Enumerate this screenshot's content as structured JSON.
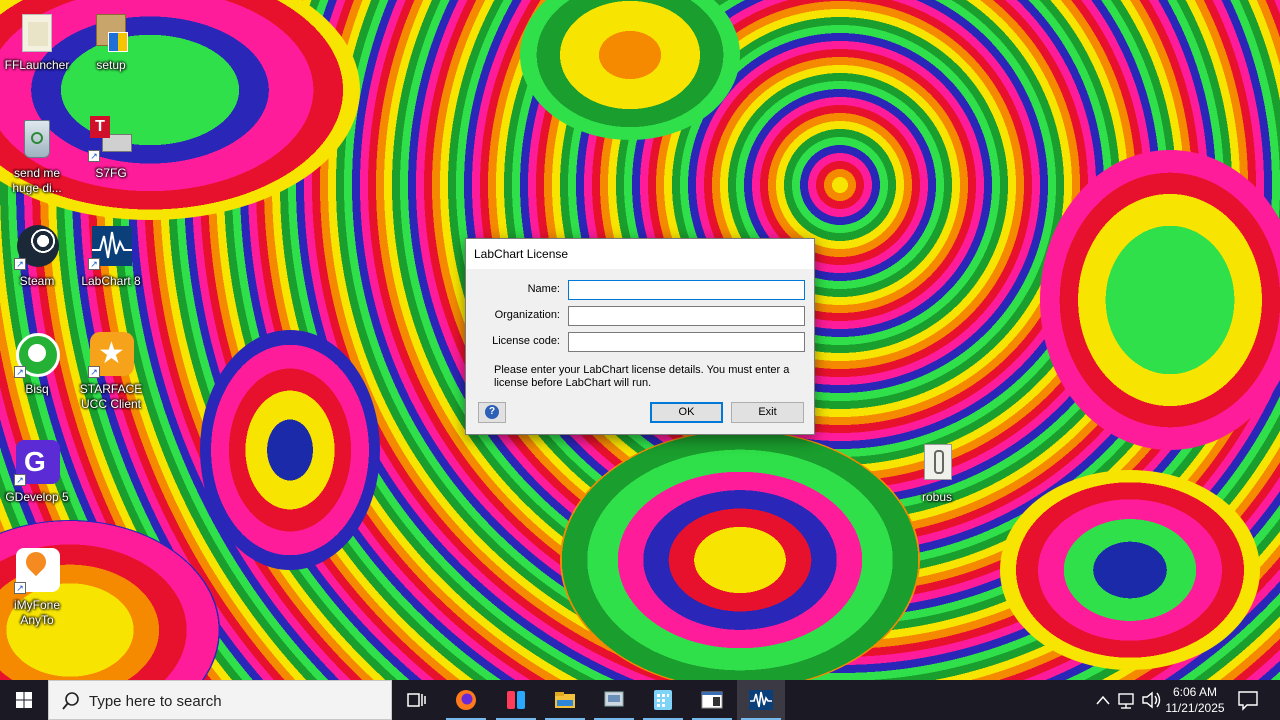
{
  "desktop": {
    "icons": [
      {
        "label": "FFLauncher",
        "icon": "folder-icon"
      },
      {
        "label": "setup",
        "icon": "installer-icon"
      },
      {
        "label": "send me huge di...",
        "icon": "recycle-bin-icon"
      },
      {
        "label": "S7FG",
        "icon": "printer-app-icon"
      },
      {
        "label": "Steam",
        "icon": "steam-icon"
      },
      {
        "label": "LabChart 8",
        "icon": "labchart-icon"
      },
      {
        "label": "Bisq",
        "icon": "bisq-icon"
      },
      {
        "label": "STARFACE UCC Client",
        "icon": "starface-icon"
      },
      {
        "label": "GDevelop 5",
        "icon": "gdevelop-icon"
      },
      {
        "label": "iMyFone AnyTo",
        "icon": "imyfone-icon"
      },
      {
        "label": "robus",
        "icon": "file-icon"
      }
    ]
  },
  "dialog": {
    "title": "LabChart License",
    "fields": [
      {
        "label": "Name:",
        "value": ""
      },
      {
        "label": "Organization:",
        "value": ""
      },
      {
        "label": "License code:",
        "value": ""
      }
    ],
    "note": "Please enter your LabChart license details. You must enter a license before LabChart will run.",
    "help_label": "?",
    "ok_label": "OK",
    "exit_label": "Exit"
  },
  "taskbar": {
    "search_placeholder": "Type here to search",
    "apps": [
      "task-view-icon",
      "firefox-icon",
      "app-icon",
      "file-explorer-icon",
      "control-panel-icon",
      "calculator-icon",
      "window-app-icon",
      "labchart-icon"
    ],
    "time": "6:06 AM",
    "date": "11/21/2025"
  },
  "colors": {
    "accent": "#0078d7",
    "taskbar": "#1b1a24",
    "dialog_bg": "#f0f0f0"
  }
}
